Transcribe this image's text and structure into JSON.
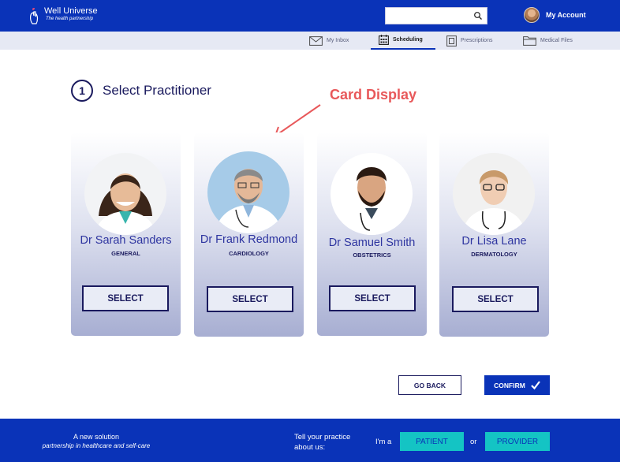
{
  "header": {
    "brand": "Well Universe",
    "tagline": "The health partnership",
    "search_placeholder": "",
    "account_label": "My Account"
  },
  "nav": {
    "tabs": [
      {
        "label": "My Inbox",
        "icon": "envelope-icon"
      },
      {
        "label": "Scheduling",
        "icon": "calendar-icon",
        "active": true
      },
      {
        "label": "Prescriptions",
        "icon": "prescription-icon"
      },
      {
        "label": "Medical Files",
        "icon": "folder-icon"
      }
    ]
  },
  "step": {
    "number": "1",
    "title": "Select Practitioner"
  },
  "annotation": {
    "label": "Card Display",
    "color": "#e8585a"
  },
  "practitioners": [
    {
      "name": "Dr Sarah Sanders",
      "specialty": "GENERAL",
      "button": "SELECT"
    },
    {
      "name": "Dr Frank Redmond",
      "specialty": "CARDIOLOGY",
      "button": "SELECT"
    },
    {
      "name": "Dr Samuel Smith",
      "specialty": "OBSTETRICS",
      "button": "SELECT"
    },
    {
      "name": "Dr Lisa Lane",
      "specialty": "DERMATOLOGY",
      "button": "SELECT"
    }
  ],
  "actions": {
    "back_label": "GO BACK",
    "confirm_label": "CONFIRM"
  },
  "footer": {
    "line1": "A new solution",
    "line2": "partnership in healthcare and self-care",
    "question_line1": "Tell your practice",
    "question_line2": "about us:",
    "im_a": "I'm a",
    "or": "or",
    "patient_label": "PATIENT",
    "provider_label": "PROVIDER"
  },
  "colors": {
    "brand_blue": "#0a33b8",
    "navy": "#1a1a5e",
    "teal": "#14c4c4",
    "annotation_red": "#e8585a"
  }
}
